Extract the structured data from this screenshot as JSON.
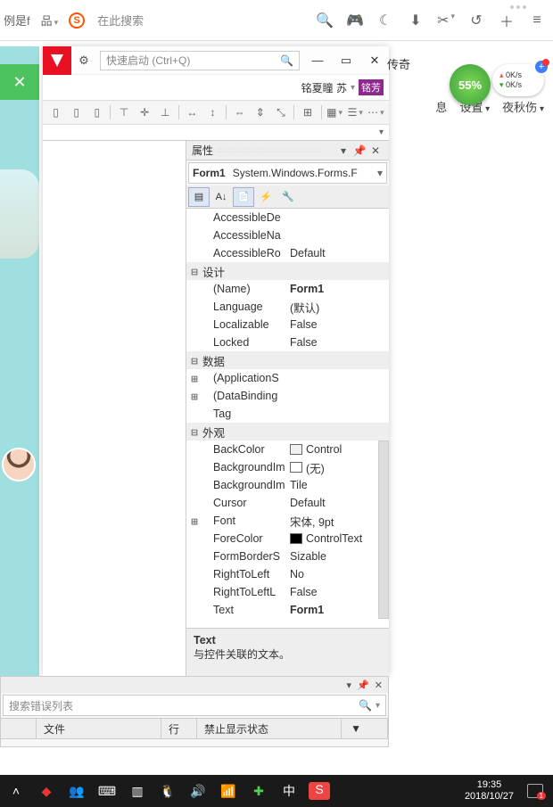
{
  "browser": {
    "truncated": "例是f",
    "grid": "品",
    "search_placeholder": "在此搜索",
    "legend": "传奇"
  },
  "floating": {
    "percent": "55%",
    "speed_up": "0K/s",
    "speed_down": "0K/s"
  },
  "right_links": [
    "息",
    "设置",
    "夜秋伤"
  ],
  "app": {
    "quick_launch": "快速启动 (Ctrl+Q)",
    "user_name": "铭夏瞳 苏",
    "user_badge": "铭芳"
  },
  "props": {
    "title": "属性",
    "object_bold": "Form1",
    "object_type": "System.Windows.Forms.F",
    "rows": [
      {
        "type": "prop",
        "exp": "",
        "name": "AccessibleDe",
        "val": ""
      },
      {
        "type": "prop",
        "exp": "",
        "name": "AccessibleNa",
        "val": ""
      },
      {
        "type": "prop",
        "exp": "",
        "name": "AccessibleRo",
        "val": "Default"
      },
      {
        "type": "cat",
        "exp": "⊟",
        "name": "设计"
      },
      {
        "type": "prop",
        "exp": "",
        "name": "(Name)",
        "val": "Form1",
        "bold": true
      },
      {
        "type": "prop",
        "exp": "",
        "name": "Language",
        "val": "(默认)"
      },
      {
        "type": "prop",
        "exp": "",
        "name": "Localizable",
        "val": "False"
      },
      {
        "type": "prop",
        "exp": "",
        "name": "Locked",
        "val": "False"
      },
      {
        "type": "cat",
        "exp": "⊟",
        "name": "数据"
      },
      {
        "type": "prop",
        "exp": "⊞",
        "name": "(ApplicationS",
        "val": ""
      },
      {
        "type": "prop",
        "exp": "⊞",
        "name": "(DataBinding",
        "val": ""
      },
      {
        "type": "prop",
        "exp": "",
        "name": "Tag",
        "val": ""
      },
      {
        "type": "cat",
        "exp": "⊟",
        "name": "外观"
      },
      {
        "type": "prop",
        "exp": "",
        "name": "BackColor",
        "val": "Control",
        "swatch": "control"
      },
      {
        "type": "prop",
        "exp": "",
        "name": "BackgroundIm",
        "val": "(无)",
        "swatch": "empty"
      },
      {
        "type": "prop",
        "exp": "",
        "name": "BackgroundIm",
        "val": "Tile"
      },
      {
        "type": "prop",
        "exp": "",
        "name": "Cursor",
        "val": "Default"
      },
      {
        "type": "prop",
        "exp": "⊞",
        "name": "Font",
        "val": "宋体, 9pt"
      },
      {
        "type": "prop",
        "exp": "",
        "name": "ForeColor",
        "val": "ControlText",
        "swatch": "black"
      },
      {
        "type": "prop",
        "exp": "",
        "name": "FormBorderS",
        "val": "Sizable"
      },
      {
        "type": "prop",
        "exp": "",
        "name": "RightToLeft",
        "val": "No"
      },
      {
        "type": "prop",
        "exp": "",
        "name": "RightToLeftL",
        "val": "False"
      },
      {
        "type": "prop",
        "exp": "",
        "name": "Text",
        "val": "Form1",
        "bold": true
      }
    ],
    "desc_title": "Text",
    "desc_text": "与控件关联的文本。"
  },
  "error": {
    "search_placeholder": "搜索错误列表",
    "col_file": "文件",
    "col_line": "行",
    "col_suppress": "禁止显示状态"
  },
  "taskbar": {
    "time": "19:35",
    "date": "2018/10/27",
    "notif": "1"
  }
}
